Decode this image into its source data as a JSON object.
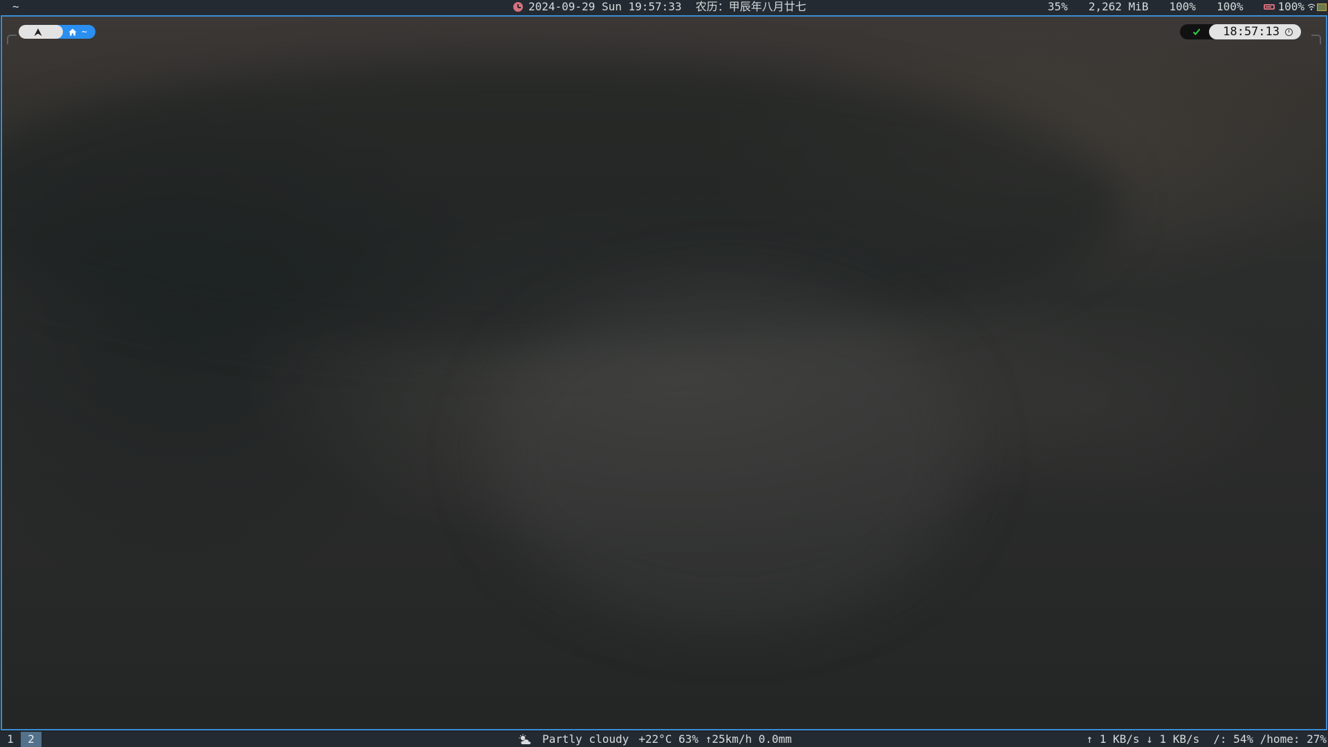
{
  "topbar": {
    "left_text": "~",
    "clock": {
      "datetime": "2024-09-29 Sun 19:57:33",
      "lunar": "农历：甲辰年八月廿七"
    },
    "stats": {
      "cpu": "35%",
      "memory": "2,262 MiB",
      "stat_a": "100%",
      "stat_b": "100%",
      "battery": "100%"
    },
    "icons": [
      "clock-icon",
      "battery-icon",
      "wifi-icon",
      "network-icon"
    ],
    "colors": {
      "bar_bg": "#242a31",
      "clock_icon": "#d7707b",
      "battery_icon": "#d7707b"
    }
  },
  "terminal": {
    "prompt": {
      "os_icon": "arch-icon",
      "dir_icon": "home-icon",
      "directory": "~"
    },
    "right_prompt": {
      "status_icon": "check-icon",
      "time": "18:57:13",
      "time_icon": "clock-icon"
    },
    "colors": {
      "border": "#3b8ed6",
      "prompt_dir_bg": "#2a8ff0",
      "prompt_os_bg": "#e3e3e3",
      "ok_check": "#2fd14d"
    }
  },
  "bottombar": {
    "workspaces": [
      {
        "label": "1",
        "active": false
      },
      {
        "label": "2",
        "active": true
      }
    ],
    "weather": {
      "icon": "partly-cloudy-icon",
      "condition": "Partly cloudy",
      "details": "+22°C 63% ↑25km/h 0.0mm"
    },
    "network": "↑ 1 KB/s ↓ 1 KB/s",
    "disk": "/: 54% /home: 27%",
    "colors": {
      "active_workspace": "#53718a"
    }
  }
}
